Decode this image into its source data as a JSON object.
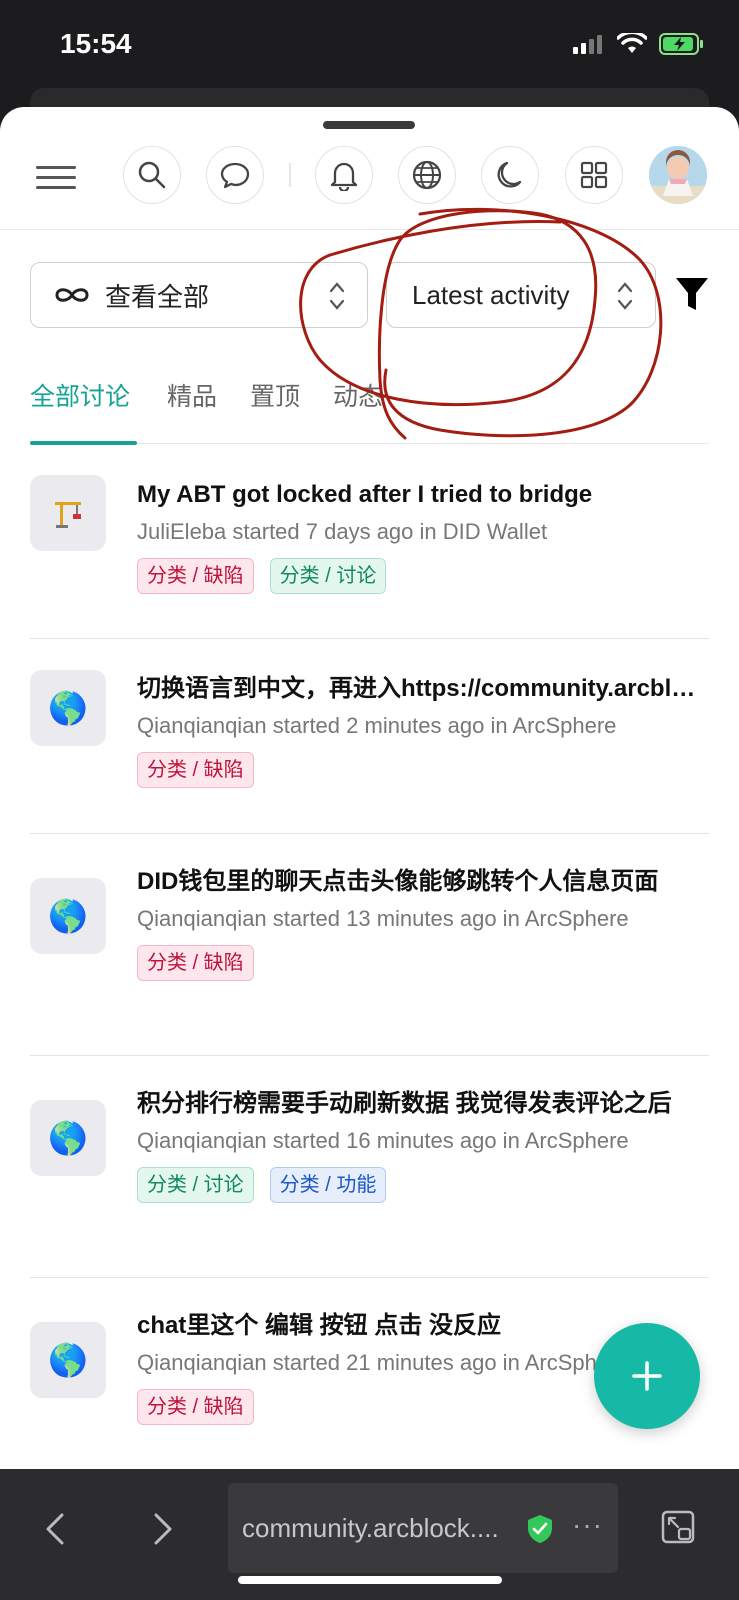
{
  "status": {
    "time": "15:54"
  },
  "toolbar": {
    "icons": [
      "menu-icon",
      "search-icon",
      "chat-icon",
      "bell-icon",
      "globe-icon",
      "moon-icon",
      "apps-icon",
      "avatar"
    ]
  },
  "filters": {
    "category_label": "查看全部",
    "sort_label": "Latest activity"
  },
  "tabs": [
    {
      "label": "全部讨论",
      "active": true
    },
    {
      "label": "精品"
    },
    {
      "label": "置顶"
    },
    {
      "label": "动态"
    }
  ],
  "discussions": [
    {
      "title": "My ABT got locked after I tried to bridge",
      "meta": "JuliEleba started 7 days ago in DID Wallet",
      "icon": "🏗️",
      "tags": [
        {
          "label": "分类 / 缺陷",
          "kind": "bug"
        },
        {
          "label": "分类 / 讨论",
          "kind": "disc"
        }
      ]
    },
    {
      "title": "切换语言到中文，再进入https://community.arcblock.io",
      "meta": "Qianqianqian started 2 minutes ago in ArcSphere",
      "icon": "🌎",
      "tags": [
        {
          "label": "分类 / 缺陷",
          "kind": "bug"
        }
      ]
    },
    {
      "title": "DID钱包里的聊天点击头像能够跳转个人信息页面",
      "meta": "Qianqianqian started 13 minutes ago in ArcSphere",
      "icon": "🌎",
      "tags": [
        {
          "label": "分类 / 缺陷",
          "kind": "bug"
        }
      ]
    },
    {
      "title": "积分排行榜需要手动刷新数据 我觉得发表评论之后",
      "meta": "Qianqianqian started 16 minutes ago in ArcSphere",
      "icon": "🌎",
      "tags": [
        {
          "label": "分类 / 讨论",
          "kind": "disc"
        },
        {
          "label": "分类 / 功能",
          "kind": "feat"
        }
      ]
    },
    {
      "title": "chat里这个 编辑 按钮 点击 没反应",
      "meta": "Qianqianqian started 21 minutes ago in ArcSphere",
      "icon": "🌎",
      "tags": [
        {
          "label": "分类 / 缺陷",
          "kind": "bug"
        }
      ]
    }
  ],
  "fab": {
    "symbol": "+"
  },
  "browser": {
    "url": "community.arcblock....",
    "dots": "···"
  },
  "colors": {
    "accent": "#16a394",
    "fab": "#16b8a6",
    "annotation": "#a31d12"
  }
}
